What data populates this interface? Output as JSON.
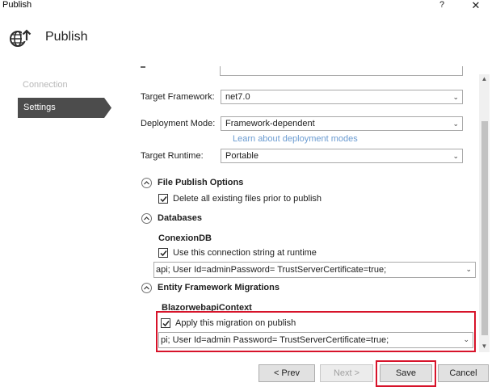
{
  "window": {
    "title": "Publish",
    "help": "?",
    "close": "✕"
  },
  "header": {
    "title": "Publish"
  },
  "nav": {
    "items": [
      {
        "label": "Connection"
      },
      {
        "label": "Settings"
      }
    ]
  },
  "form": {
    "target_framework": {
      "label": "Target Framework:",
      "value": "net7.0"
    },
    "deployment_mode": {
      "label": "Deployment Mode:",
      "value": "Framework-dependent",
      "link": "Learn about deployment modes"
    },
    "target_runtime": {
      "label": "Target Runtime:",
      "value": "Portable"
    }
  },
  "file_publish": {
    "title": "File Publish Options",
    "delete_label": "Delete all existing files prior to publish",
    "delete_checked": true
  },
  "databases": {
    "title": "Databases",
    "name": "ConexionDB",
    "use_label": "Use this connection string at runtime",
    "use_checked": true,
    "connection": "api; User Id=adminPassword= TrustServerCertificate=true;"
  },
  "ef": {
    "title": "Entity Framework Migrations",
    "context": "BlazorwebapiContext",
    "apply_label": "Apply this migration on publish",
    "apply_checked": true,
    "connection": "pi; User Id=admin Password= TrustServerCertificate=true;"
  },
  "buttons": {
    "prev": "< Prev",
    "next": "Next >",
    "save": "Save",
    "cancel": "Cancel"
  },
  "colors": {
    "accent": "#4c4c4c",
    "highlight": "#d7132a",
    "link": "#6a9bd1"
  }
}
